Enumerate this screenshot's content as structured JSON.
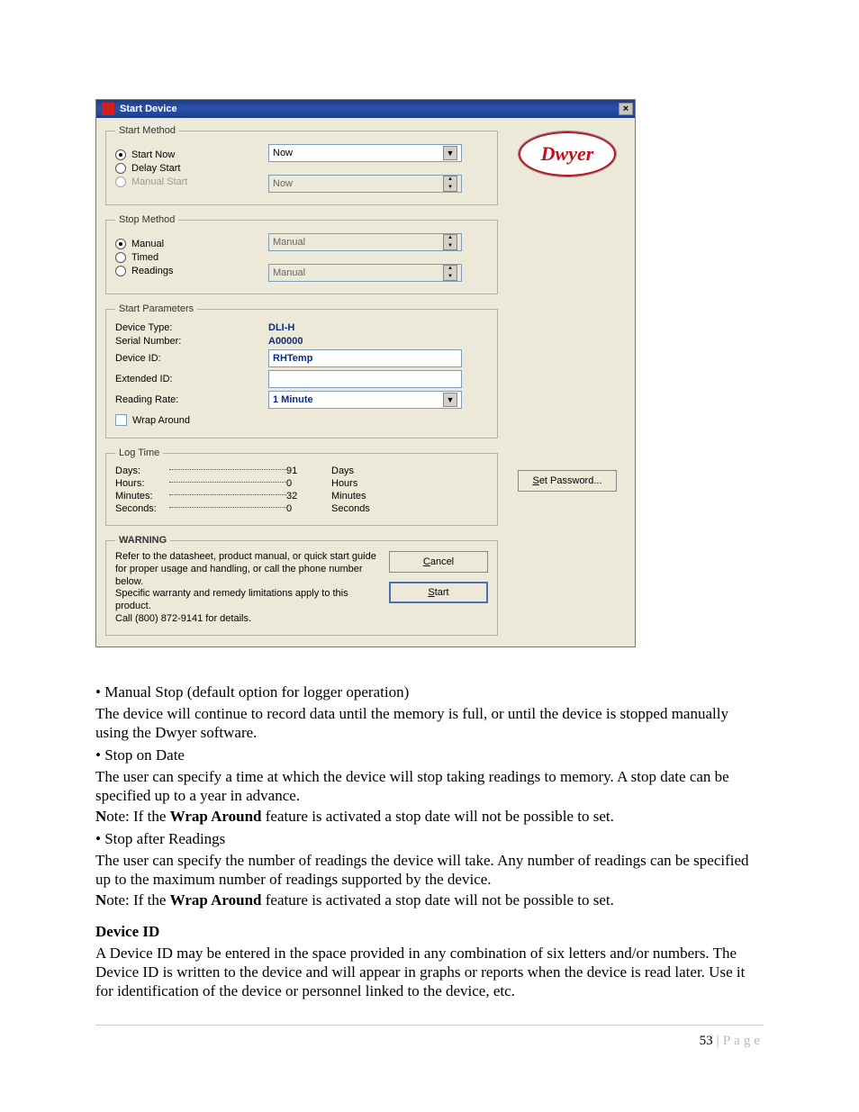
{
  "dialog": {
    "title": "Start Device",
    "close_glyph": "×",
    "logo_text": "Dwyer",
    "groups": {
      "start_method": {
        "legend": "Start Method",
        "radios": {
          "start_now": "Start Now",
          "delay_start": "Delay Start",
          "manual_start": "Manual Start"
        },
        "dropdown1_value": "Now",
        "spinner1_value": "Now"
      },
      "stop_method": {
        "legend": "Stop Method",
        "radios": {
          "manual": "Manual",
          "timed": "Timed",
          "readings": "Readings"
        },
        "spinner1_value": "Manual",
        "spinner2_value": "Manual"
      },
      "start_params": {
        "legend": "Start Parameters",
        "labels": {
          "device_type": "Device Type:",
          "serial_number": "Serial Number:",
          "device_id": "Device ID:",
          "extended_id": "Extended ID:",
          "reading_rate": "Reading Rate:",
          "wrap": "Wrap Around"
        },
        "values": {
          "device_type": "DLI-H",
          "serial_number": "A00000",
          "device_id": "RHTemp",
          "extended_id": "",
          "reading_rate": "1 Minute"
        }
      },
      "log_time": {
        "legend": "Log Time",
        "rows": [
          {
            "label": "Days:",
            "value": "91",
            "unit": "Days"
          },
          {
            "label": "Hours:",
            "value": "0",
            "unit": "Hours"
          },
          {
            "label": "Minutes:",
            "value": "32",
            "unit": "Minutes"
          },
          {
            "label": "Seconds:",
            "value": "0",
            "unit": "Seconds"
          }
        ]
      },
      "warning": {
        "legend": "WARNING",
        "text_line1": "Refer to the datasheet, product manual, or quick start guide for proper usage and handling, or call the phone number below.",
        "text_line2": "Specific warranty and remedy limitations apply to this product.",
        "text_line3": "Call (800) 872-9141 for details."
      }
    },
    "buttons": {
      "set_password_pre": "S",
      "set_password_rest": "et Password...",
      "cancel_pre": "C",
      "cancel_rest": "ancel",
      "start_pre": "S",
      "start_rest": "tart"
    }
  },
  "doc": {
    "b1_title": "Manual Stop (default option for logger operation)",
    "b1_body": "The device will continue to record data until the memory is full, or until the device is stopped manually using the Dwyer software.",
    "b2_title": "Stop on Date",
    "b2_body": "The user can specify a time at which the device will stop taking readings to memory. A stop date can be specified up to a year in advance.",
    "note_pre_bold": "N",
    "note_rest1": "ote: If the ",
    "wrap_bold": "Wrap Around",
    "note_rest2": " feature is activated a stop date will not be possible to set.",
    "b3_title": "Stop after Readings",
    "b3_body": "The user can specify the number of readings the device will take. Any number of readings can be specified up to the maximum number of readings supported by the device.",
    "device_id_head": "Device ID",
    "device_id_body": "A Device ID may be entered in the space provided in any combination of six letters and/or numbers. The Device ID is written to the device and will appear in graphs or reports when the device is read later. Use it for identification of the device or personnel linked to the device, etc.",
    "page_number": "53",
    "page_sep": " | ",
    "page_word": "Page"
  }
}
